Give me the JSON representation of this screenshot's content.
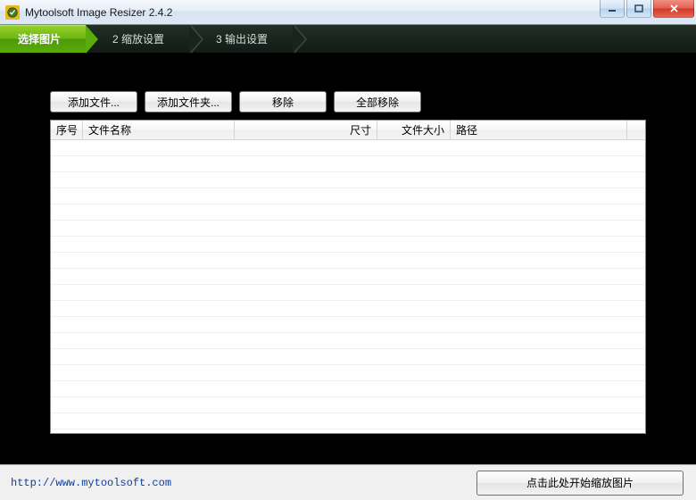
{
  "window": {
    "title": "Mytoolsoft Image Resizer 2.4.2"
  },
  "steps": {
    "s1": "选择图片",
    "s2": "2 缩放设置",
    "s3": "3 输出设置"
  },
  "toolbar": {
    "add_file": "添加文件...",
    "add_folder": "添加文件夹...",
    "remove": "移除",
    "remove_all": "全部移除"
  },
  "table": {
    "headers": {
      "index": "序号",
      "filename": "文件名称",
      "dimensions": "尺寸",
      "filesize": "文件大小",
      "path": "路径"
    },
    "rows": []
  },
  "footer": {
    "link_text": "http://www.mytoolsoft.com",
    "start_label": "点击此处开始缩放图片"
  }
}
